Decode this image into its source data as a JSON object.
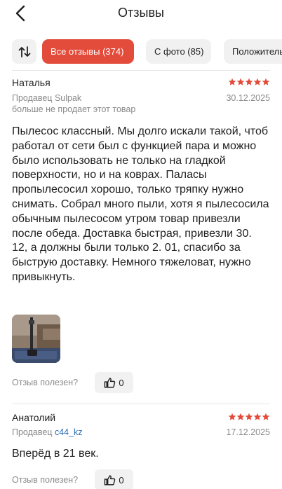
{
  "header": {
    "title": "Отзывы",
    "back_icon": "chevron-left-icon"
  },
  "filters": {
    "sort_icon": "sort-arrows-icon",
    "chips": [
      {
        "label": "Все отзывы (374)",
        "active": true
      },
      {
        "label": "С фото (85)",
        "active": false
      },
      {
        "label": "Положительные",
        "active": false
      }
    ]
  },
  "reviews": [
    {
      "author": "Наталья",
      "rating": 5,
      "seller_prefix": "Продавец ",
      "seller_name": "Sulpak",
      "date": "30.12.2025",
      "note": "больше не продает этот товар",
      "text": "Пылесос классный. Мы долго искали такой, чтоб работал от сети был с функцией пара и можно было использовать не только на гладкой поверхности, но и на коврах. Паласы пропылесосил хорошо, только тряпку нужно снимать. Собрал много пыли, хотя я пылесосила обычным пылесосом утром товар привезли после обеда. Доставка быстрая, привезли 30. 12, а должны были только 2. 01, спасибо за быструю доставку. Немного тяжеловат, нужно привыкнуть.",
      "has_photo": true,
      "helpful_label": "Отзыв полезен?",
      "likes": "0"
    },
    {
      "author": "Анатолий",
      "rating": 5,
      "seller_prefix": "Продавец ",
      "seller_name": "c44_kz",
      "date": "17.12.2025",
      "text": "Вперёд в 21 век.",
      "helpful_label": "Отзыв полезен?",
      "likes": "0"
    }
  ],
  "colors": {
    "accent": "#e34b3a",
    "star": "#e34b3a",
    "link": "#2f6fb5",
    "muted": "#8a8a8a"
  }
}
